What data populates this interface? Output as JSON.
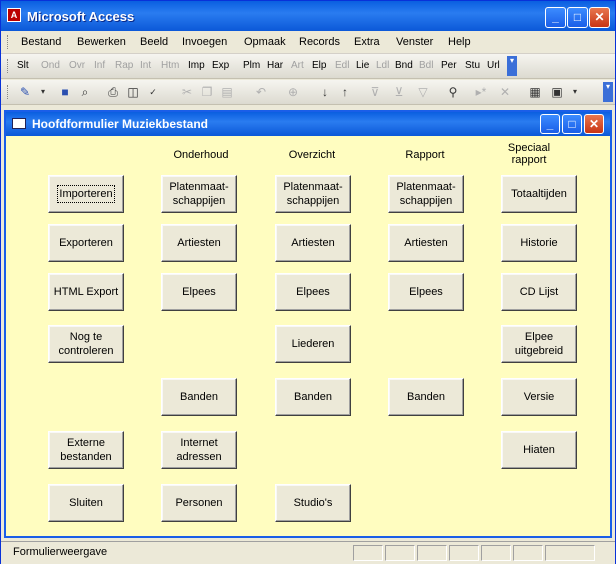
{
  "app": {
    "title": "Microsoft Access"
  },
  "menu": {
    "items": [
      "Bestand",
      "Bewerken",
      "Beeld",
      "Invoegen",
      "Opmaak",
      "Records",
      "Extra",
      "Venster",
      "Help"
    ]
  },
  "toolbar1": {
    "items": [
      "Slt",
      "Ond",
      "Ovr",
      "Inf",
      "Rap",
      "Int",
      "Htm",
      "Imp",
      "Exp",
      "Plm",
      "Har",
      "Art",
      "Elp",
      "Edl",
      "Lie",
      "Ldl",
      "Bnd",
      "Bdl",
      "Per",
      "Stu",
      "Url"
    ]
  },
  "form": {
    "title": "Hoofdformulier Muziekbestand",
    "headers": {
      "onderhoud": "Onderhoud",
      "overzicht": "Overzicht",
      "rapport": "Rapport",
      "speciaal": "Speciaal rapport"
    },
    "col1": [
      "Importeren",
      "Exporteren",
      "HTML Export",
      "Nog te controleren",
      "Externe bestanden",
      "Sluiten"
    ],
    "col2": [
      "Platenmaat-schappijen",
      "Artiesten",
      "Elpees",
      "Banden",
      "Internet adressen",
      "Personen"
    ],
    "col3": [
      "Platenmaat-schappijen",
      "Artiesten",
      "Elpees",
      "Liederen",
      "Banden",
      "Studio's"
    ],
    "col4": [
      "Platenmaat-schappijen",
      "Artiesten",
      "Elpees",
      "Banden"
    ],
    "col5": [
      "Totaaltijden",
      "Historie",
      "CD Lijst",
      "Elpee uitgebreid",
      "Versie",
      "Hiaten"
    ]
  },
  "status": {
    "text": "Formulierweergave"
  },
  "colors": {
    "title_blue": "#0a5fe0",
    "form_bg": "#fffdc0",
    "close_red": "#c83414"
  }
}
